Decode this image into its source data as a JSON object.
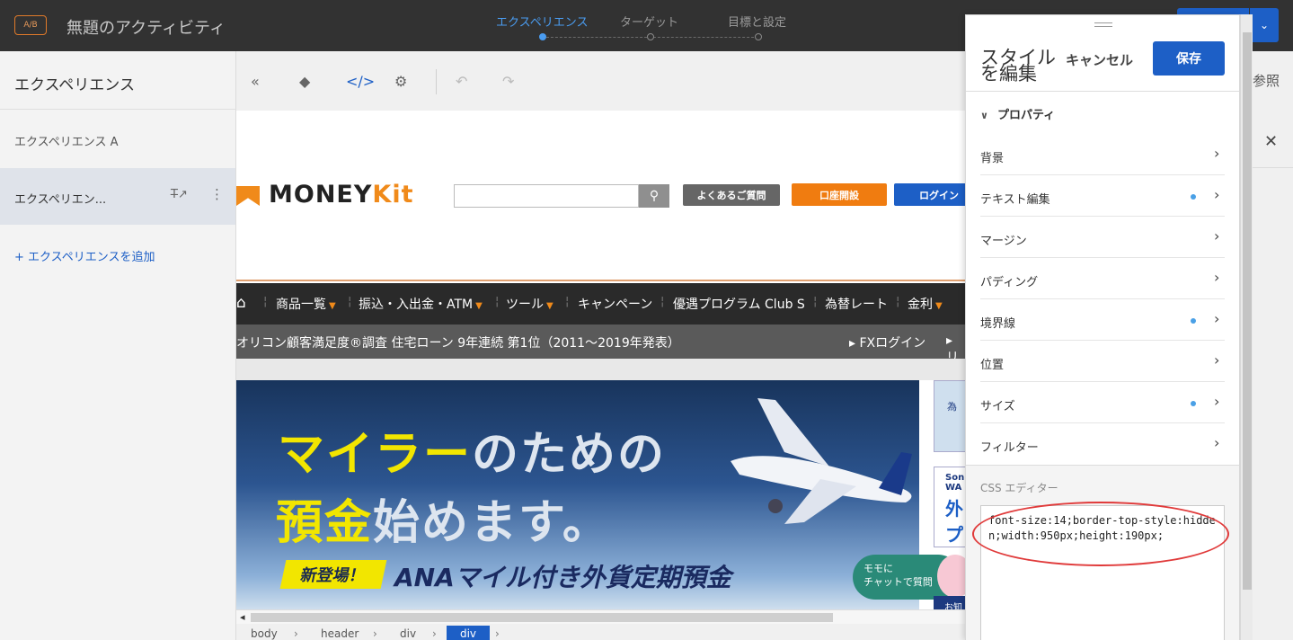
{
  "topbar": {
    "ab_badge": "A/B",
    "activity_title": "無題のアクティビティ",
    "steps": [
      {
        "label": "エクスペリエンス",
        "active": true
      },
      {
        "label": "ターゲット",
        "active": false
      },
      {
        "label": "目標と設定",
        "active": false
      }
    ],
    "dropdown_icon": "chevron-down-icon"
  },
  "left_panel": {
    "title": "エクスペリエンス",
    "experience_a": "エクスペリエンス A",
    "experience_b": "エクスペリエン...",
    "add_experience": "+ エクスペリエンスを追加"
  },
  "toolbar": {
    "icons": [
      "collapse-icon",
      "layers-icon",
      "code-icon",
      "settings-icon",
      "undo-icon",
      "redo-icon"
    ],
    "browse_label": "参照",
    "close_label": "✕"
  },
  "site": {
    "logo_text": "MONEY",
    "logo_text_accent": "Kit",
    "faq_button": "よくあるご質問",
    "open_account_button": "口座開設",
    "login_button": "ログイン",
    "nav_items": [
      "商品一覧",
      "振込・入出金・ATM",
      "ツール",
      "キャンペーン",
      "優遇プログラム Club S",
      "為替レート",
      "金利"
    ],
    "sub_text": "オリコン顧客満足度®調査 住宅ローン 9年連続 第1位（2011～2019年発表）",
    "sub_fx": "▸ FXログイン",
    "sub_more": "▸ リ",
    "banner_line1_yellow": "マイラー",
    "banner_line1_white": "のための",
    "banner_line2_yellow": "預金",
    "banner_line2_white": "始めます。",
    "banner_new": "新登場！",
    "banner_ana": "ANAマイル付き外貨定期預金",
    "side_promo1_text": "為",
    "side_promo2_line1": "Son",
    "side_promo2_line2": "WA",
    "side_promo2_big": "外",
    "side_promo2_big2": "プ",
    "chat_line1": "モモに",
    "chat_line2": "チャットで質問",
    "side_bottom": "お知"
  },
  "breadcrumb": [
    "body",
    "header",
    "div",
    "div"
  ],
  "style_editor": {
    "title": "スタイルを編集",
    "cancel": "キャンセル",
    "save": "保存",
    "properties_header": "プロパティ",
    "rows": [
      {
        "label": "背景",
        "dot": false
      },
      {
        "label": "テキスト編集",
        "dot": true
      },
      {
        "label": "マージン",
        "dot": false
      },
      {
        "label": "パディング",
        "dot": false
      },
      {
        "label": "境界線",
        "dot": true
      },
      {
        "label": "位置",
        "dot": false
      },
      {
        "label": "サイズ",
        "dot": true
      },
      {
        "label": "フィルター",
        "dot": false
      }
    ],
    "css_editor_label": "CSS エディター",
    "css_text": "font-size:14;border-top-style:hidden;width:950px;height:190px;"
  },
  "colors": {
    "accent_blue": "#1d5fc6",
    "brand_orange": "#f08a1a",
    "highlight_red": "#e03a3a"
  }
}
